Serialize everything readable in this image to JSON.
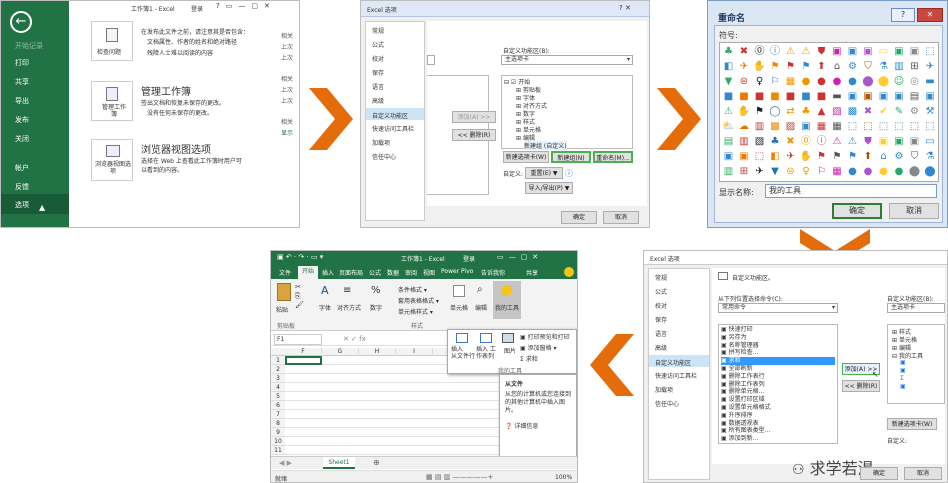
{
  "p1": {
    "sidebar": [
      "开始记录",
      "打印",
      "共享",
      "导出",
      "发布",
      "关闭",
      "帐户",
      "反馈",
      "选项"
    ],
    "items": [
      {
        "btn": "检查问题",
        "title": "",
        "desc": [
          "在发布此文件之前，请注意其是否包含：",
          "文档属性、作者的姓名和绝对路径",
          "残障人士难以阅读的内容"
        ]
      },
      {
        "btn": "管理工作簿",
        "title": "管理工作簿",
        "desc": [
          "签出文档和恢复未保存的更改。",
          "没有任何未保存的更改。"
        ]
      },
      {
        "btn": "浏览器视图选项",
        "title": "浏览器视图选项",
        "desc": [
          "选择在 Web 上查看此工作簿时用户可",
          "以看到的内容。"
        ]
      }
    ],
    "title": "工作簿1 - Excel",
    "login": "登录",
    "right": [
      "相关",
      "上次",
      "上次",
      "相关",
      "上次",
      "上次",
      "相关",
      "显示"
    ]
  },
  "p2": {
    "title": "Excel 选项",
    "nav": [
      "常规",
      "公式",
      "校对",
      "保存",
      "语言",
      "高级",
      "自定义功能区",
      "快速访问工具栏",
      "加载项",
      "信任中心"
    ],
    "customize_label": "自定义功能区(B):",
    "main_tabs": "主选项卡",
    "tree": [
      "开始",
      "剪贴板",
      "字体",
      "对齐方式",
      "数字",
      "样式",
      "单元格",
      "编辑",
      "新建组 (自定义)"
    ],
    "add": "添加(A) >>",
    "remove": "<< 删除(R)",
    "new_tab": "新建选项卡(W)",
    "new_group": "新建组(N)",
    "rename": "重命名(M)...",
    "customize": "自定义:",
    "reset": "重置(E) ▼",
    "import_export": "导入/导出(P) ▼",
    "ok": "确定",
    "cancel": "取消"
  },
  "p3": {
    "title": "重命名",
    "symbol_label": "符号:",
    "display_label": "显示名称:",
    "display_value": "我的工具",
    "ok": "确定",
    "cancel": "取消"
  },
  "p4": {
    "title": "Excel 选项",
    "nav": [
      "常规",
      "公式",
      "校对",
      "保存",
      "语言",
      "高级",
      "自定义功能区",
      "快速访问工具栏",
      "加载项",
      "信任中心"
    ],
    "heading": "自定义功能区。",
    "choose_label": "从下列位置选择命令(C):",
    "choose_value": "常用命令",
    "customize_label": "自定义功能区(B):",
    "main_tabs": "主选项卡",
    "commands": [
      "快速打印",
      "另存为",
      "名称管理器",
      "拼写检查...",
      "求和",
      "全部刷新",
      "删除工作表行",
      "删除工作表列",
      "删除单元格...",
      "设置打印区域",
      "设置单元格格式",
      "升序排序",
      "数据透视表",
      "所有图表类型...",
      "添加到新..."
    ],
    "tree": [
      "样式",
      "单元格",
      "编辑",
      "我的工具"
    ],
    "add": "添加(A) >>",
    "remove": "<< 删除(R)",
    "new_tab": "新建选项卡(W)",
    "customize": "自定义:",
    "ok": "确定",
    "cancel": "取消",
    "watermark": "求学若渴"
  },
  "p5": {
    "title": "工作簿1 - Excel",
    "login": "登录",
    "tabs": [
      "文件",
      "开始",
      "插入",
      "页面布局",
      "公式",
      "数据",
      "审阅",
      "视图",
      "Power Pivo",
      "告诉我你",
      "共享"
    ],
    "groups": {
      "clipboard": "剪贴板",
      "paste": "粘贴",
      "font": "字体",
      "align": "对齐方式",
      "number": "数字",
      "styles": "样式",
      "cond": "条件格式 ▾",
      "table": "套用表格格式 ▾",
      "cellstyle": "单元格样式 ▾",
      "cells": "单元格",
      "edit": "编辑",
      "mytools": "我的工具"
    },
    "namebox": "F1",
    "cols": [
      "F",
      "G",
      "H",
      "I"
    ],
    "rows": [
      "1",
      "2",
      "3",
      "4",
      "5",
      "6",
      "7",
      "8",
      "9",
      "10",
      "11"
    ],
    "popup": {
      "insert_table": "插入\n从文件",
      "insert_photo": "插入\n工作簿",
      "pic": "图片",
      "print_preview": "打印预览和打印",
      "add_sheet": "添加窗格 ▾",
      "sum": "求和",
      "label": "我的工具"
    },
    "tooltip": {
      "title": "从文件",
      "body": "从您的计算机或您连接到的其他计算机中插入图片。",
      "more": "详细信息"
    },
    "sheet": "Sheet1",
    "status": "就绪",
    "zoom": "100%"
  }
}
